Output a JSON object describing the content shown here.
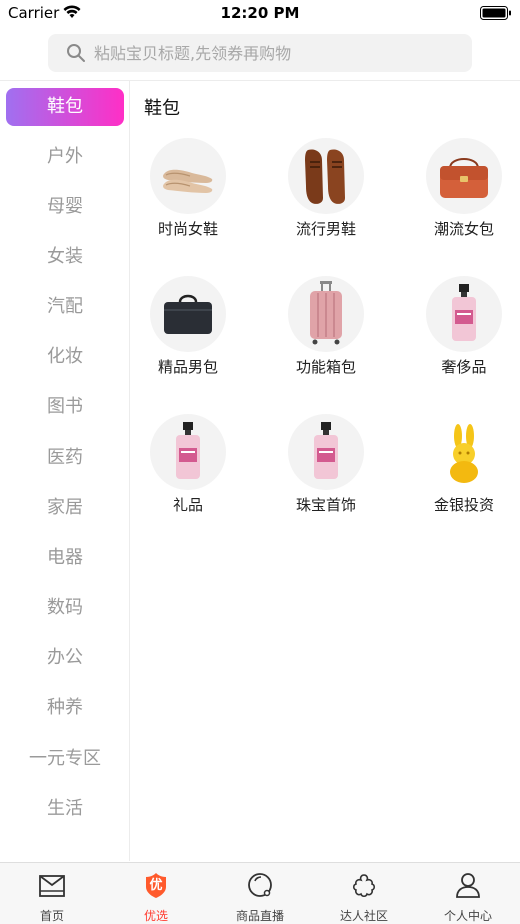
{
  "status_bar": {
    "carrier": "Carrier",
    "time": "12:20 PM"
  },
  "search": {
    "placeholder": "粘贴宝贝标题,先领券再购物",
    "value": ""
  },
  "sidebar": {
    "items": [
      {
        "label": "鞋包",
        "active": true
      },
      {
        "label": "户外",
        "active": false
      },
      {
        "label": "母婴",
        "active": false
      },
      {
        "label": "女装",
        "active": false
      },
      {
        "label": "汽配",
        "active": false
      },
      {
        "label": "化妆",
        "active": false
      },
      {
        "label": "图书",
        "active": false
      },
      {
        "label": "医药",
        "active": false
      },
      {
        "label": "家居",
        "active": false
      },
      {
        "label": "电器",
        "active": false
      },
      {
        "label": "数码",
        "active": false
      },
      {
        "label": "办公",
        "active": false
      },
      {
        "label": "种养",
        "active": false
      },
      {
        "label": "一元专区",
        "active": false
      },
      {
        "label": "生活",
        "active": false
      }
    ]
  },
  "content": {
    "title": "鞋包",
    "categories": [
      {
        "label": "时尚女鞋",
        "icon": "womens-shoes-icon"
      },
      {
        "label": "流行男鞋",
        "icon": "mens-shoes-icon"
      },
      {
        "label": "潮流女包",
        "icon": "womens-bag-icon"
      },
      {
        "label": "精品男包",
        "icon": "mens-bag-icon"
      },
      {
        "label": "功能箱包",
        "icon": "luggage-icon"
      },
      {
        "label": "奢侈品",
        "icon": "perfume-icon"
      },
      {
        "label": "礼品",
        "icon": "perfume-icon"
      },
      {
        "label": "珠宝首饰",
        "icon": "perfume-icon"
      },
      {
        "label": "金银投资",
        "icon": "gold-rabbit-icon"
      }
    ]
  },
  "tabbar": {
    "tabs": [
      {
        "label": "首页",
        "icon": "home-icon",
        "active": false
      },
      {
        "label": "优选",
        "icon": "selection-badge-icon",
        "active": true,
        "badge_text": "优"
      },
      {
        "label": "商品直播",
        "icon": "live-icon",
        "active": false
      },
      {
        "label": "达人社区",
        "icon": "community-icon",
        "active": false
      },
      {
        "label": "个人中心",
        "icon": "profile-icon",
        "active": false
      }
    ]
  },
  "colors": {
    "accent_start": "#a070f0",
    "accent_end": "#ff2fc6",
    "tab_active": "#ff3b2f",
    "sidebar_inactive_text": "#9a9a9a"
  }
}
